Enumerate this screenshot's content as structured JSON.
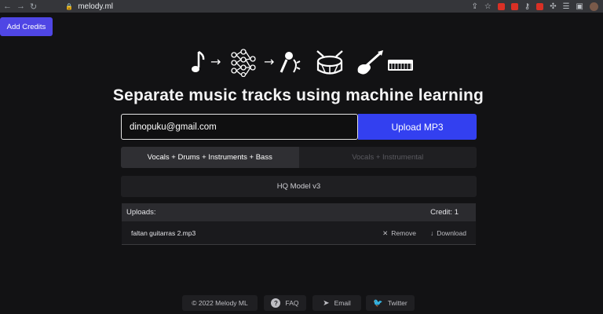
{
  "browser": {
    "url": "melody.ml"
  },
  "header": {
    "add_credits_label": "Add Credits"
  },
  "hero": {
    "title": "Separate music tracks using machine learning"
  },
  "form": {
    "email_value": "dinopuku@gmail.com",
    "upload_label": "Upload MP3"
  },
  "separation_options": [
    {
      "label": "Vocals + Drums + Instruments + Bass",
      "active": true
    },
    {
      "label": "Vocals + Instrumental",
      "active": false
    }
  ],
  "model": {
    "label": "HQ Model v3"
  },
  "uploads": {
    "title": "Uploads:",
    "credit": "Credit: 1",
    "files": [
      {
        "name": "faltan guitarras 2.mp3",
        "remove_label": "Remove",
        "download_label": "Download"
      }
    ]
  },
  "footer": {
    "copyright": "© 2022 Melody ML",
    "faq": "FAQ",
    "email": "Email",
    "twitter": "Twitter"
  },
  "colors": {
    "background": "#121214",
    "accent": "#3340f0",
    "add_credits": "#4f46e5"
  }
}
